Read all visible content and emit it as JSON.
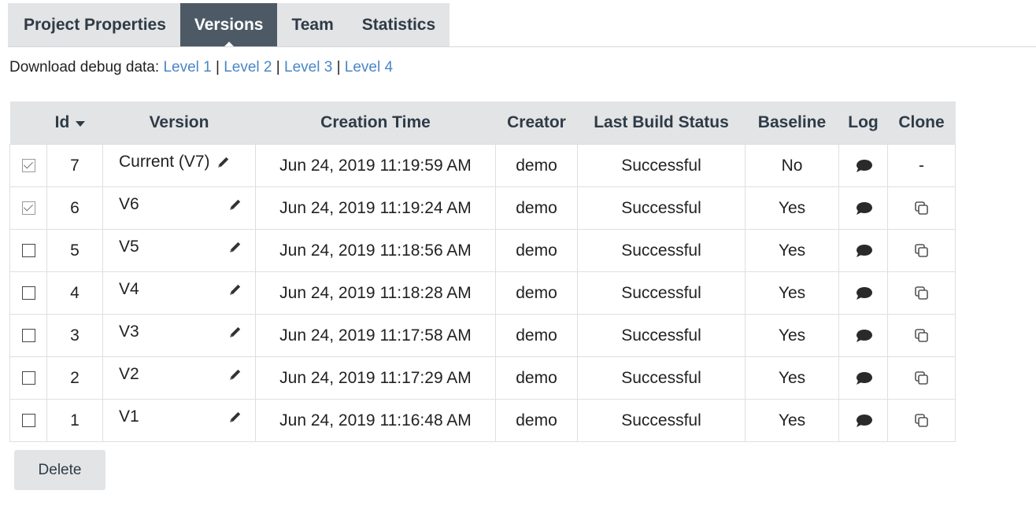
{
  "tabs": [
    {
      "label": "Project Properties",
      "active": false
    },
    {
      "label": "Versions",
      "active": true
    },
    {
      "label": "Team",
      "active": false
    },
    {
      "label": "Statistics",
      "active": false
    }
  ],
  "debug": {
    "prefix": "Download debug data:",
    "levels": [
      "Level 1",
      "Level 2",
      "Level 3",
      "Level 4"
    ],
    "separator": "|"
  },
  "columns": {
    "id": "Id",
    "version": "Version",
    "creation_time": "Creation Time",
    "creator": "Creator",
    "last_build_status": "Last Build Status",
    "baseline": "Baseline",
    "log": "Log",
    "clone": "Clone"
  },
  "rows": [
    {
      "checked": true,
      "id": "7",
      "version": "Current (V7)",
      "time": "Jun 24, 2019 11:19:59 AM",
      "creator": "demo",
      "status": "Successful",
      "baseline": "No",
      "clone": "-"
    },
    {
      "checked": true,
      "id": "6",
      "version": "V6",
      "time": "Jun 24, 2019 11:19:24 AM",
      "creator": "demo",
      "status": "Successful",
      "baseline": "Yes",
      "clone": "clone-icon"
    },
    {
      "checked": false,
      "id": "5",
      "version": "V5",
      "time": "Jun 24, 2019 11:18:56 AM",
      "creator": "demo",
      "status": "Successful",
      "baseline": "Yes",
      "clone": "clone-icon"
    },
    {
      "checked": false,
      "id": "4",
      "version": "V4",
      "time": "Jun 24, 2019 11:18:28 AM",
      "creator": "demo",
      "status": "Successful",
      "baseline": "Yes",
      "clone": "clone-icon"
    },
    {
      "checked": false,
      "id": "3",
      "version": "V3",
      "time": "Jun 24, 2019 11:17:58 AM",
      "creator": "demo",
      "status": "Successful",
      "baseline": "Yes",
      "clone": "clone-icon"
    },
    {
      "checked": false,
      "id": "2",
      "version": "V2",
      "time": "Jun 24, 2019 11:17:29 AM",
      "creator": "demo",
      "status": "Successful",
      "baseline": "Yes",
      "clone": "clone-icon"
    },
    {
      "checked": false,
      "id": "1",
      "version": "V1",
      "time": "Jun 24, 2019 11:16:48 AM",
      "creator": "demo",
      "status": "Successful",
      "baseline": "Yes",
      "clone": "clone-icon"
    }
  ],
  "icons": {
    "edit": "pencil-icon",
    "log": "speech-bubble-icon",
    "sort": "caret-down-icon"
  },
  "colors": {
    "active_tab": "#4d5a66",
    "tab_bg": "#e2e4e6",
    "link": "#4a86c5"
  },
  "actions": {
    "delete_label": "Delete"
  }
}
